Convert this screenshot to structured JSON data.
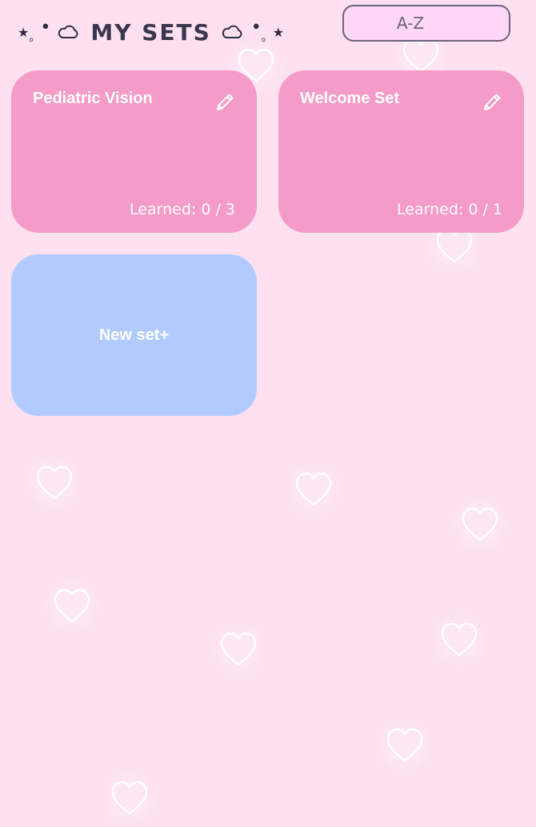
{
  "header": {
    "title": "MY SETS",
    "deco_star": "★",
    "deco_small": "。",
    "deco_dot": "•"
  },
  "sort": {
    "selected": "A-Z",
    "options": [
      "A-Z"
    ]
  },
  "sets": [
    {
      "title": "Pediatric Vision",
      "learned": "Learned: 0 / 3"
    },
    {
      "title": "Welcome Set",
      "learned": "Learned: 0 / 1"
    }
  ],
  "new_set": {
    "label": "New set+"
  },
  "colors": {
    "background": "#fde1f1",
    "set_card": "#f59bc7",
    "new_card": "#b2cbff",
    "title_text": "#3b3650",
    "select_bg": "#fdd7f8"
  },
  "icons": {
    "edit": "pencil-icon",
    "background": "heart-outline-icon",
    "header": "cloud-icon"
  }
}
